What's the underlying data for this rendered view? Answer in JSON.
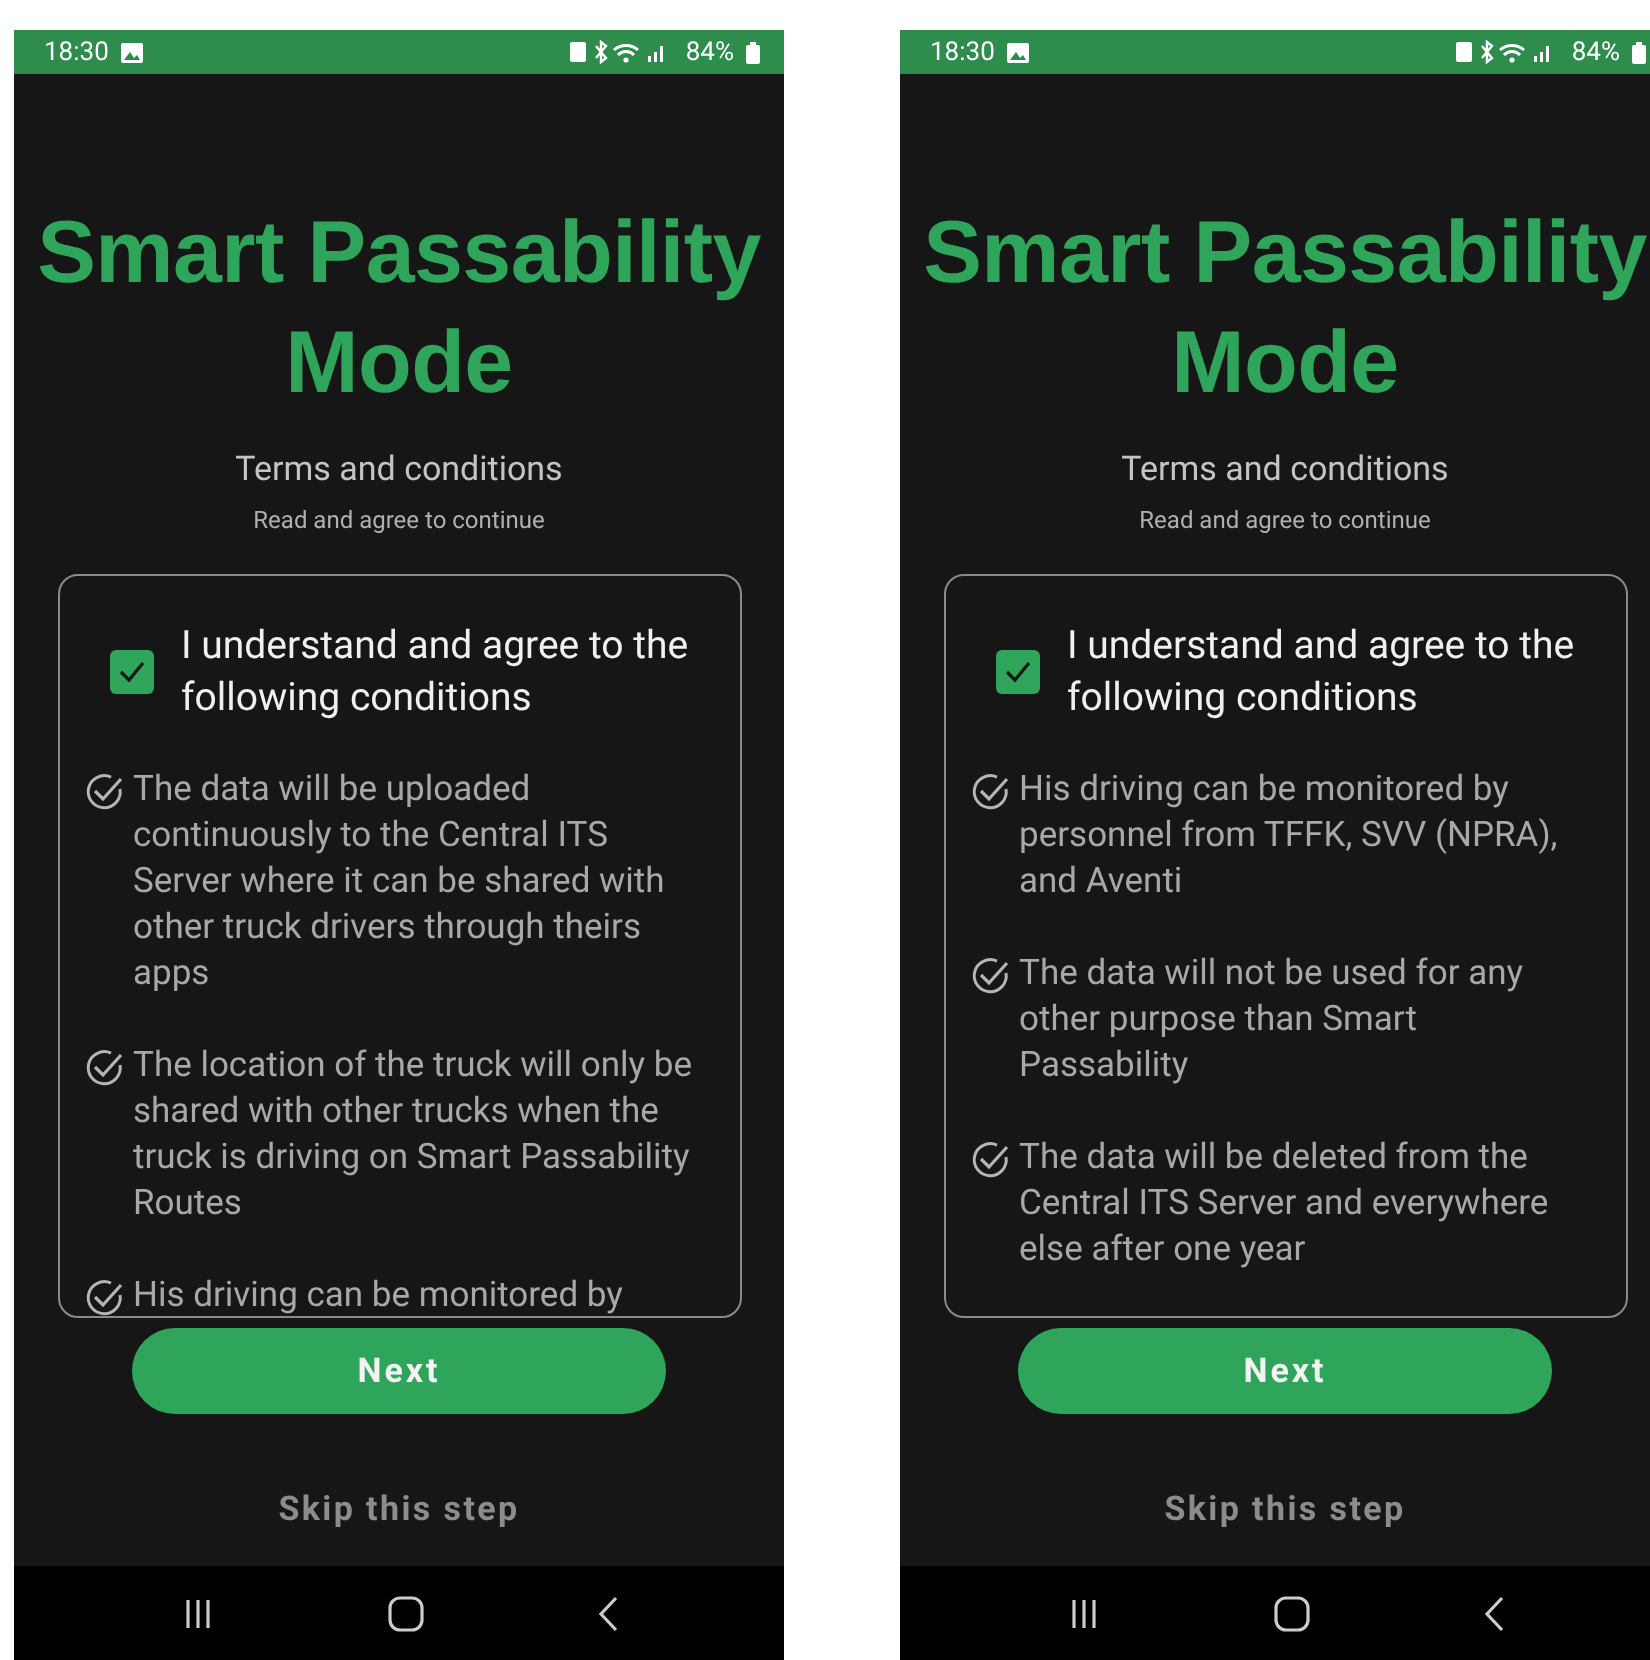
{
  "screens": [
    {
      "status_bar": {
        "time": "18:30",
        "battery": "84%"
      },
      "title": "Smart Passability Mode",
      "subtitle": "Terms and conditions",
      "hint": "Read and agree to continue",
      "agree": {
        "label": "I understand and agree to the following conditions",
        "checked": true
      },
      "conditions": [
        "The data will be uploaded continuously to the Central ITS Server where it can be shared with other truck drivers through theirs apps",
        "The location of the truck will only be shared with other trucks when the truck is driving on Smart Passability Routes",
        "His driving can be monitored by"
      ],
      "next_button": "Next",
      "skip_link": "Skip this step"
    },
    {
      "status_bar": {
        "time": "18:30",
        "battery": "84%"
      },
      "title": "Smart Passability Mode",
      "subtitle": "Terms and conditions",
      "hint": "Read and agree to continue",
      "agree": {
        "label": "I understand and agree to the following conditions",
        "checked": true
      },
      "conditions": [
        "His driving can be monitored by personnel from TFFK, SVV (NPRA), and Aventi",
        "The data will not be used for any other purpose than Smart Passability",
        "The data will be deleted from the Central ITS Server and everywhere else after one year"
      ],
      "next_button": "Next",
      "skip_link": "Skip this step"
    }
  ]
}
